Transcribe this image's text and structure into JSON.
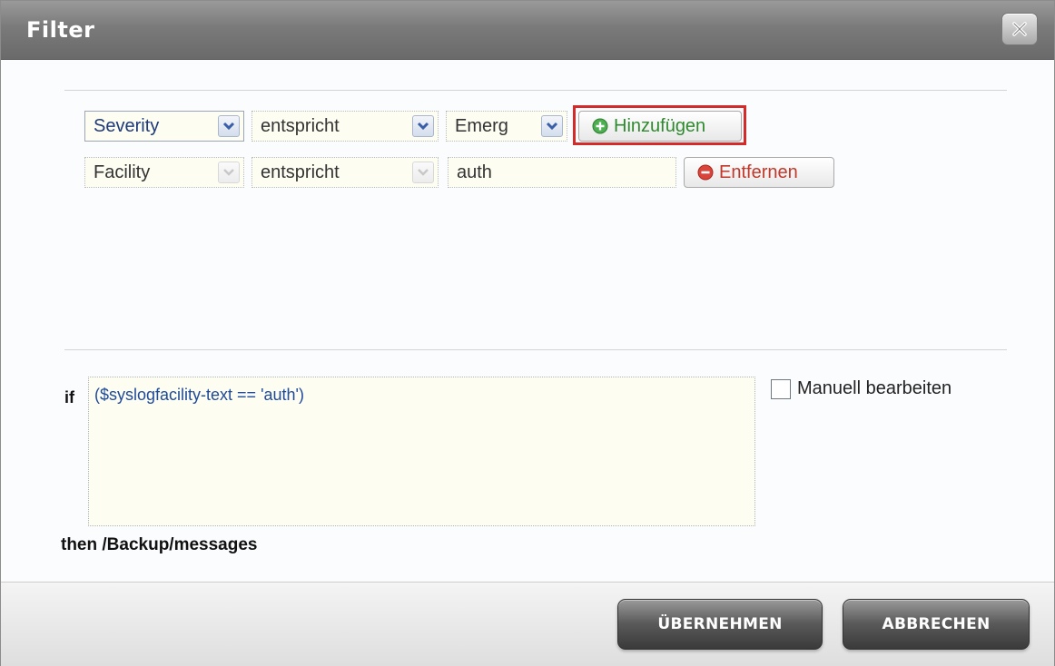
{
  "dialog": {
    "title": "Filter"
  },
  "filter_rows": [
    {
      "field": "Severity",
      "operator": "entspricht",
      "value": "Emerg",
      "action": "Hinzufügen"
    },
    {
      "field": "Facility",
      "operator": "entspricht",
      "value": "auth",
      "action": "Entfernen"
    }
  ],
  "condition": {
    "if_label": "if",
    "expression": "($syslogfacility-text == 'auth')",
    "manual_edit_label": "Manuell bearbeiten",
    "manual_edit_checked": false,
    "then_label": "then /Backup/messages"
  },
  "footer": {
    "apply_label": "ÜBERNEHMEN",
    "cancel_label": "ABBRECHEN"
  },
  "colors": {
    "add_icon": "#4caf50",
    "remove_icon": "#d9453a",
    "highlight": "#d42a2a",
    "dropdown_arrow": "#3b5ea8"
  }
}
